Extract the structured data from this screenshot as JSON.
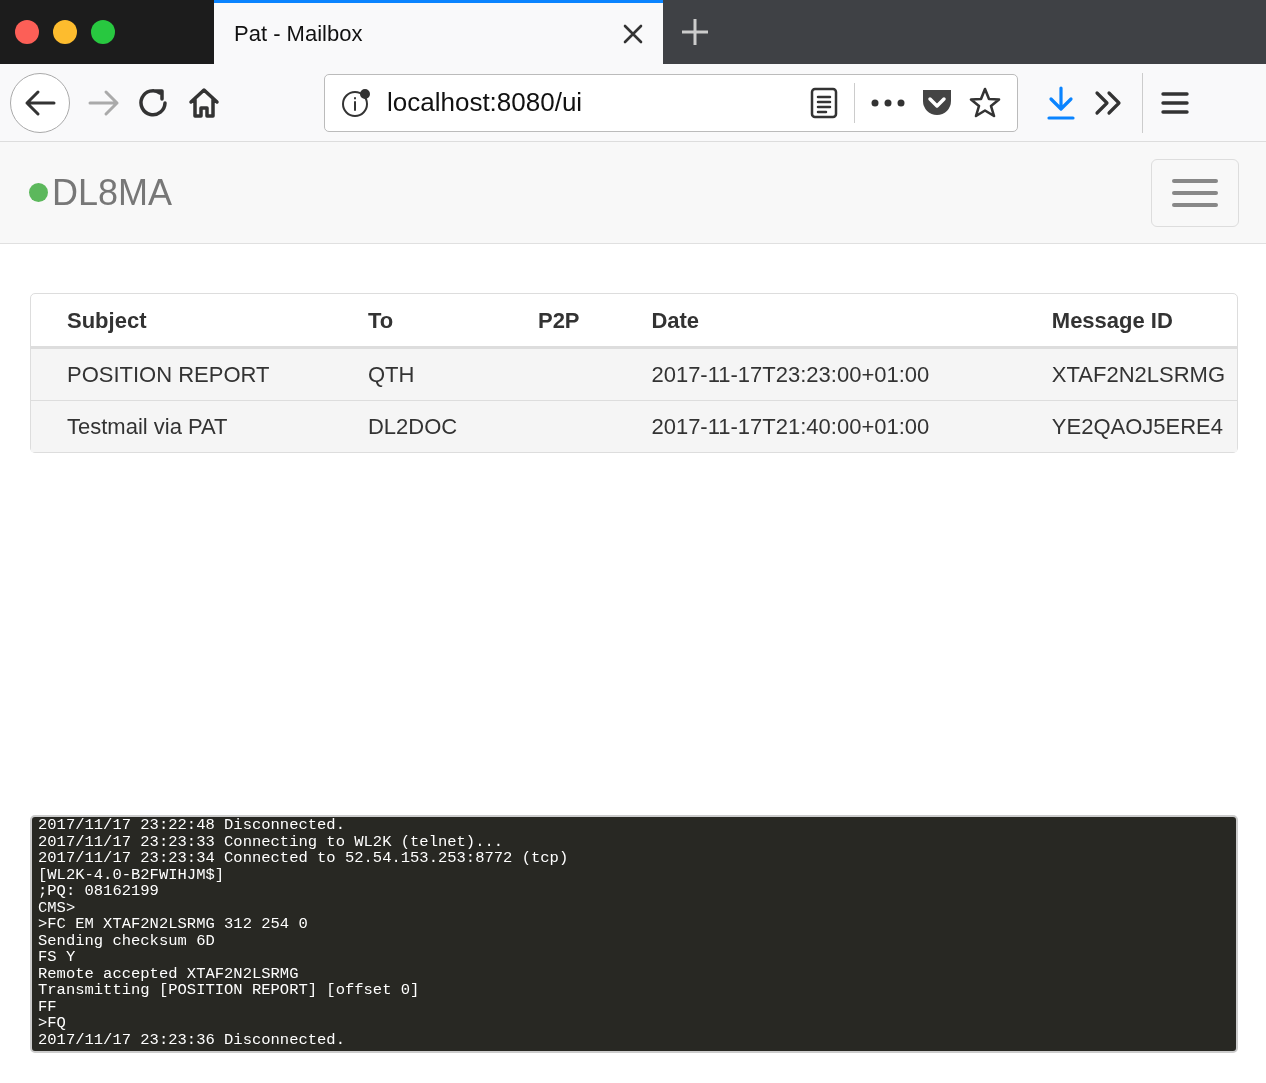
{
  "browser": {
    "tab_title": "Pat - Mailbox",
    "url": "localhost:8080/ui"
  },
  "navbar": {
    "callsign": "DL8MA",
    "connected": true
  },
  "table": {
    "columns": [
      "Subject",
      "To",
      "P2P",
      "Date",
      "Message ID"
    ],
    "rows": [
      [
        "POSITION REPORT",
        "QTH",
        "",
        "2017-11-17T23:23:00+01:00",
        "XTAF2N2LSRMG"
      ],
      [
        "Testmail via PAT",
        "DL2DOC",
        "",
        "2017-11-17T21:40:00+01:00",
        "YE2QAOJ5ERE4"
      ]
    ]
  },
  "console": {
    "lines": [
      "2017/11/17 23:22:48 Disconnected.",
      "2017/11/17 23:23:33 Connecting to WL2K (telnet)...",
      "2017/11/17 23:23:34 Connected to 52.54.153.253:8772 (tcp)",
      "[WL2K-4.0-B2FWIHJM$]",
      ";PQ: 08162199",
      "CMS>",
      ">FC EM XTAF2N2LSRMG 312 254 0",
      "Sending checksum 6D",
      "FS Y",
      "Remote accepted XTAF2N2LSRMG",
      "Transmitting [POSITION REPORT] [offset 0]",
      "FF",
      ">FQ",
      "2017/11/17 23:23:36 Disconnected."
    ]
  }
}
